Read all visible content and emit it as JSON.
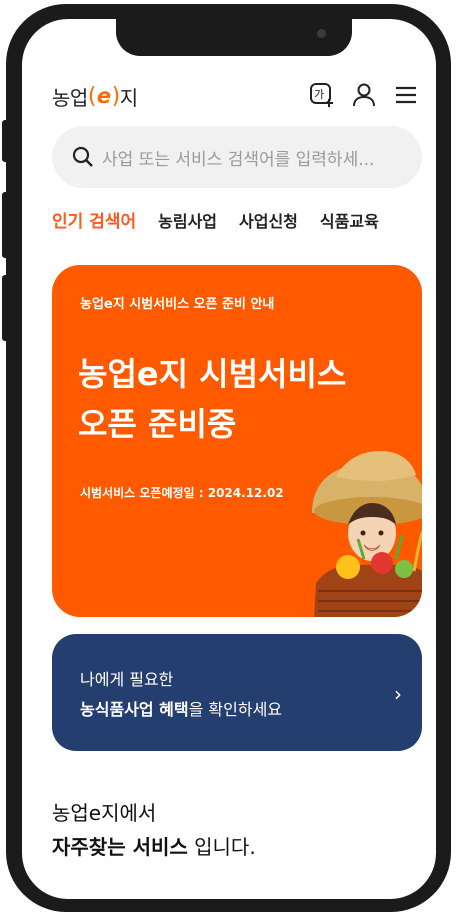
{
  "header": {
    "logo_pre": "농업",
    "logo_paren_open": "(",
    "logo_e": "e",
    "logo_paren_close": ")",
    "logo_post": "지",
    "icons": [
      "text-size-icon",
      "user-icon",
      "menu-icon"
    ],
    "text_size_label": "가"
  },
  "search": {
    "placeholder": "사업 또는 서비스 검색어를 입력하세..."
  },
  "tabs": [
    {
      "label": "인기 검색어",
      "active": true
    },
    {
      "label": "농림사업",
      "active": false
    },
    {
      "label": "사업신청",
      "active": false
    },
    {
      "label": "식품교육",
      "active": false
    }
  ],
  "banner": {
    "eyebrow": "농업e지 시범서비스 오픈 준비 안내",
    "title_line1": "농업e지 시범서비스",
    "title_line2": "오픈 준비중",
    "date": "시범서비스 오픈예정일 : 2024.12.02",
    "bg_color": "#ff5a00"
  },
  "benefit": {
    "line1": "나에게 필요한",
    "line2_bold": "농식품사업 혜택",
    "line2_rest": "을 확인하세요",
    "chevron": "›",
    "bg_color": "#253e70"
  },
  "frequent": {
    "line1": "농업e지에서",
    "line2_bold": "자주찾는 서비스",
    "line2_rest": " 입니다."
  }
}
